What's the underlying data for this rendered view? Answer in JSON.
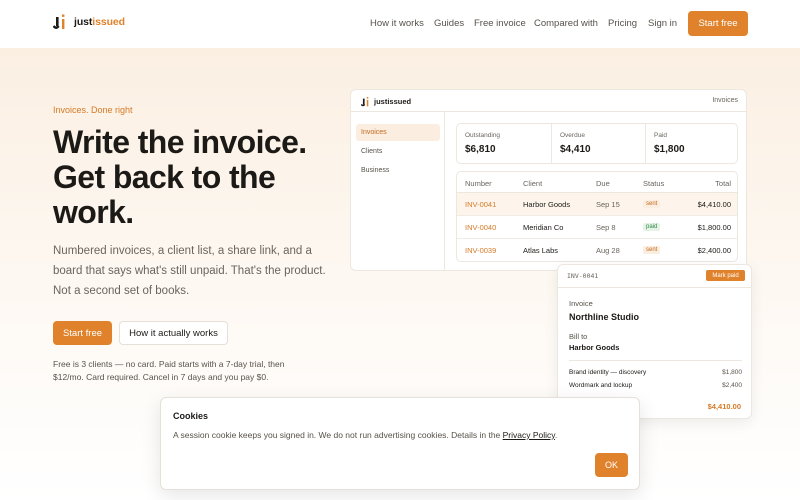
{
  "brand": {
    "name_dark": "just",
    "name_accent": "issued",
    "accent": "#e0822b"
  },
  "nav": {
    "items": [
      "How it works",
      "Guides",
      "Free invoice",
      "Compared with",
      "Pricing",
      "Sign in"
    ],
    "cta": "Start free"
  },
  "hero": {
    "eyebrow": "Invoices. Done right",
    "headline": [
      "Write the invoice.",
      "Get back to the",
      "work."
    ],
    "sub": "Numbered invoices, a client list, a share link, and a board that says what's still unpaid. That's the product. Not a second set of books.",
    "cta_primary": "Start free",
    "cta_secondary": "How it actually works",
    "pricing_note": "Free is 3 clients — no card. Paid starts with a 7-day trial, then $12/mo. Card required. Cancel in 7 days and you pay $0."
  },
  "app": {
    "brand": "justissued",
    "top_right": "Invoices",
    "sidebar": [
      "Invoices",
      "Clients",
      "Business"
    ],
    "stats": [
      {
        "label": "Outstanding",
        "value": "$6,810"
      },
      {
        "label": "Overdue",
        "value": "$4,410"
      },
      {
        "label": "Paid",
        "value": "$1,800"
      }
    ],
    "columns": [
      "Number",
      "Client",
      "Due",
      "Status",
      "Total"
    ],
    "rows": [
      {
        "number": "INV-0041",
        "client": "Harbor Goods",
        "due": "Sep 15",
        "status": "sent",
        "total": "$4,410.00"
      },
      {
        "number": "INV-0040",
        "client": "Meridian Co",
        "due": "Sep 8",
        "status": "paid",
        "total": "$1,800.00"
      },
      {
        "number": "INV-0039",
        "client": "Atlas Labs",
        "due": "Aug 28",
        "status": "sent",
        "total": "$2,400.00"
      }
    ]
  },
  "invoice_card": {
    "id": "INV-0041",
    "action": "Mark paid",
    "label": "Invoice",
    "from": "Northline Studio",
    "bill_to_label": "Bill to",
    "bill_to": "Harbor Goods",
    "lines": [
      {
        "desc": "Brand identity — discovery",
        "amount": "$1,800"
      },
      {
        "desc": "Wordmark and lockup",
        "amount": "$2,400"
      }
    ],
    "total": "$4,410.00"
  },
  "cookie": {
    "title": "Cookies",
    "text": "A session cookie keeps you signed in. We do not run advertising cookies. Details in the ",
    "link": "Privacy Policy",
    "text_end": ".",
    "ok": "OK"
  }
}
